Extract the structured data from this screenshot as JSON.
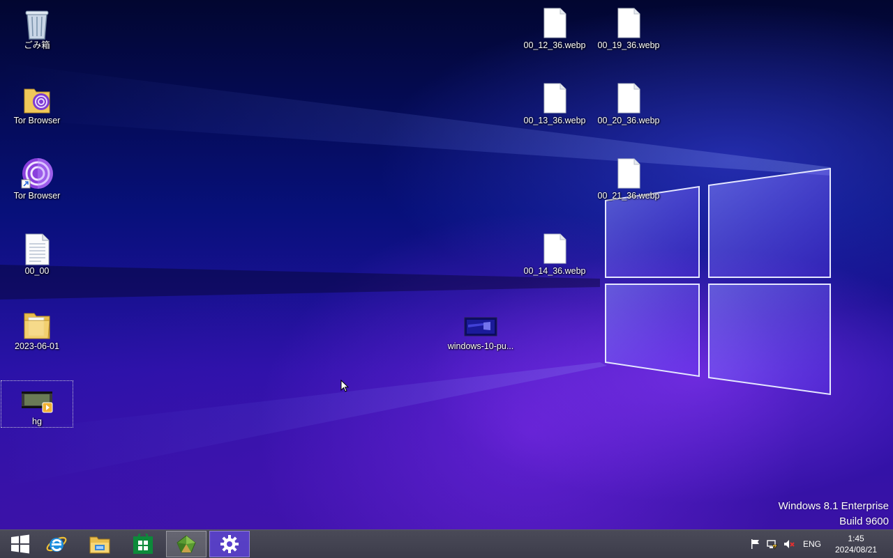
{
  "desktop_icons": [
    {
      "label": "ごみ箱",
      "icon": "recycle-bin-icon"
    },
    {
      "label": "Tor Browser",
      "icon": "tor-browser-folder-icon"
    },
    {
      "label": "Tor Browser",
      "icon": "tor-browser-shortcut-icon"
    },
    {
      "label": "00_00",
      "icon": "text-file-icon"
    },
    {
      "label": "2023-06-01",
      "icon": "folder-icon"
    },
    {
      "label": "hg",
      "icon": "video-file-icon",
      "selected": true
    },
    {
      "label": "00_12_36.webp",
      "icon": "file-icon"
    },
    {
      "label": "00_19_36.webp",
      "icon": "file-icon"
    },
    {
      "label": "00_13_36.webp",
      "icon": "file-icon"
    },
    {
      "label": "00_20_36.webp",
      "icon": "file-icon"
    },
    {
      "label": "00_21_36.webp",
      "icon": "file-icon"
    },
    {
      "label": "00_14_36.webp",
      "icon": "file-icon"
    },
    {
      "label": "windows-10-pu...",
      "icon": "image-file-icon"
    }
  ],
  "watermark": {
    "line1": "Windows 8.1 Enterprise",
    "line2": "Build 9600"
  },
  "taskbar": {
    "buttons": [
      {
        "icon": "start-icon"
      },
      {
        "icon": "internet-explorer-icon"
      },
      {
        "icon": "file-explorer-icon"
      },
      {
        "icon": "store-icon"
      },
      {
        "icon": "green-app-icon",
        "active": true
      },
      {
        "icon": "settings-gear-icon",
        "active": true
      }
    ],
    "tray": {
      "icons": [
        "flag-icon",
        "network-icon",
        "volume-muted-icon"
      ],
      "language": "ENG",
      "time": "1:45",
      "date": "2024/08/21"
    }
  },
  "colors": {
    "accent": "#2a12a8",
    "taskbar": "#3c3c4a",
    "active_tile": "#5a3fd0"
  }
}
